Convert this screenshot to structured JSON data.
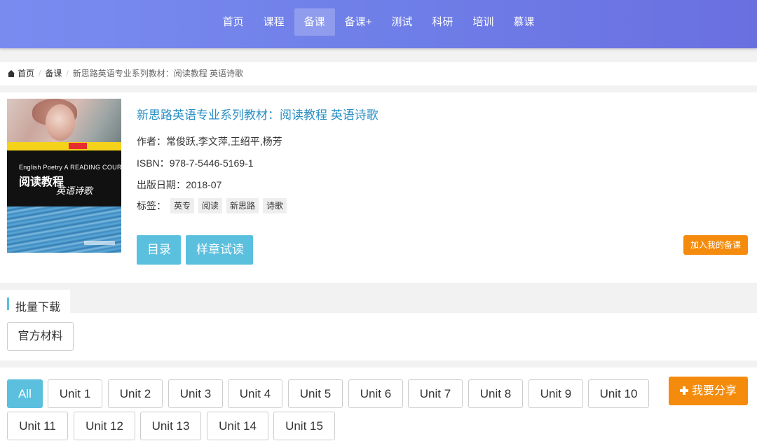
{
  "nav": {
    "items": [
      {
        "label": "首页"
      },
      {
        "label": "课程"
      },
      {
        "label": "备课"
      },
      {
        "label": "备课+"
      },
      {
        "label": "测试"
      },
      {
        "label": "科研"
      },
      {
        "label": "培训"
      },
      {
        "label": "慕课"
      }
    ],
    "active": "备课"
  },
  "breadcrumb": {
    "home": "首页",
    "section": "备课",
    "current": "新思路英语专业系列教材：阅读教程 英语诗歌"
  },
  "book": {
    "title": "新思路英语专业系列教材：阅读教程 英语诗歌",
    "author_label": "作者：",
    "author": "常俊跃,李文萍,王绍平,杨芳",
    "isbn_label": "ISBN：",
    "isbn": "978-7-5446-5169-1",
    "date_label": "出版日期：",
    "date": "2018-07",
    "tags_label": "标签：",
    "tags": [
      "英专",
      "阅读",
      "新思路",
      "诗歌"
    ],
    "cover": {
      "en_title": "English Poetry A READING COURSE",
      "cn_title": "阅读教程",
      "cn_subtitle": "英语诗歌"
    }
  },
  "actions": {
    "toc": "目录",
    "sample": "样章试读",
    "add": "加入我的备课"
  },
  "download": {
    "title": "批量下载",
    "material": "官方材料"
  },
  "units": {
    "items": [
      "All",
      "Unit 1",
      "Unit 2",
      "Unit 3",
      "Unit 4",
      "Unit 5",
      "Unit 6",
      "Unit 7",
      "Unit 8",
      "Unit 9",
      "Unit 10",
      "Unit 11",
      "Unit 12",
      "Unit 13",
      "Unit 14",
      "Unit 15"
    ],
    "active": "All",
    "share": "我要分享"
  },
  "colors": {
    "header_gradient": [
      "#7a8bf0",
      "#6a6fe0"
    ],
    "accent_blue": "#5bc0de",
    "accent_orange": "#f58b0c",
    "title_blue": "#2a8fc4"
  }
}
